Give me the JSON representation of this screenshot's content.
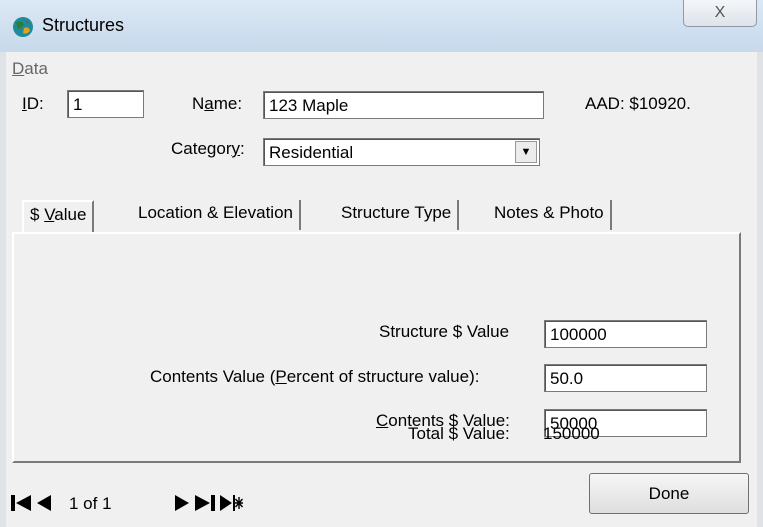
{
  "window": {
    "title": "Structures",
    "close_glyph": "X"
  },
  "menu": {
    "data_label_prefix": "",
    "data_label_underlined": "D",
    "data_label_rest": "ata"
  },
  "record": {
    "id_label_underlined": "I",
    "id_label_rest": "D:",
    "id_value": "1",
    "name_label_pre": "N",
    "name_label_underlined": "a",
    "name_label_rest": "me:",
    "name_value": "123 Maple",
    "aad_text": "AAD: $10920.",
    "category_label_pre": "Categor",
    "category_label_underlined": "y",
    "category_label_rest": ":",
    "category_value": "Residential"
  },
  "tabs": [
    {
      "pre": "$ ",
      "underlined": "V",
      "rest": "alue",
      "active": true
    },
    {
      "pre": "Location & Elevation",
      "underlined": "",
      "rest": "",
      "active": false
    },
    {
      "pre": "Structure Type",
      "underlined": "",
      "rest": "",
      "active": false
    },
    {
      "pre": "Notes & Photo",
      "underlined": "",
      "rest": "",
      "active": false
    }
  ],
  "value_tab": {
    "structure_value_label": "Structure $ Value",
    "structure_value": "100000",
    "contents_pct_label_pre": "Contents Value (",
    "contents_pct_label_underlined": "P",
    "contents_pct_label_rest": "ercent of structure value):",
    "contents_pct_value": "50.0",
    "contents_value_label_underlined": "C",
    "contents_value_label_rest": "ontents $ Value:",
    "contents_value": "50000",
    "total_label": "Total $ Value:",
    "total_value": "150000"
  },
  "navigation": {
    "position_text": "1 of 1",
    "done_label": "Done"
  }
}
